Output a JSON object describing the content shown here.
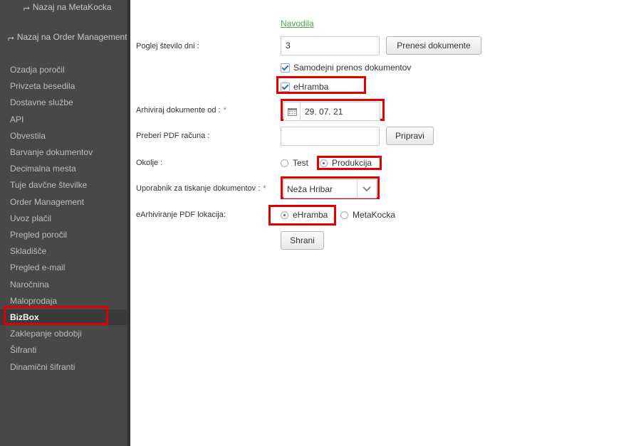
{
  "sidebar": {
    "back_metakocka": "Nazaj na MetaKocka",
    "back_order_management": "Nazaj na Order Management",
    "items": [
      {
        "label": "Ozadja poročil"
      },
      {
        "label": "Privzeta besedila"
      },
      {
        "label": "Dostavne službe"
      },
      {
        "label": "API"
      },
      {
        "label": "Obvestila"
      },
      {
        "label": "Barvanje dokumentov"
      },
      {
        "label": "Decimalna mesta"
      },
      {
        "label": "Tuje davčne številke"
      },
      {
        "label": "Order Management"
      },
      {
        "label": "Uvoz plačil"
      },
      {
        "label": "Pregled poročil"
      },
      {
        "label": "Skladišče"
      },
      {
        "label": "Pregled e-mail"
      },
      {
        "label": "Naročnina"
      },
      {
        "label": "Maloprodaja"
      },
      {
        "label": "BizBox"
      },
      {
        "label": "Zaklepanje obdobji"
      },
      {
        "label": "Šifranti"
      },
      {
        "label": "Dinamični šifranti"
      }
    ],
    "active": "BizBox"
  },
  "form": {
    "instructions_link": "Navodila",
    "days_label": "Poglej število dni :",
    "days_value": "3",
    "transfer_button": "Prenesi dokumente",
    "auto_transfer_label": "Samodejni prenos dokumentov",
    "ehramba_check_label": "eHramba",
    "archive_from_label": "Arhiviraj dokumente od :",
    "archive_from_value": "29. 07. 21",
    "review_pdf_label": "Preberi PDF računa :",
    "review_pdf_value": "",
    "prepare_button": "Pripravi",
    "environment_label": "Okolje :",
    "env_test": "Test",
    "env_production": "Produkcija",
    "print_user_label": "Uporabnik za tiskanje dokumentov :",
    "print_user_value": "Neža Hribar",
    "pdf_location_label": "eArhiviranje PDF lokacija:",
    "loc_ehramba": "eHramba",
    "loc_metakocka": "MetaKocka",
    "save_button": "Shrani",
    "required_mark": "*"
  },
  "colors": {
    "sidebar_bg": "#484848",
    "highlight": "#e00000",
    "link": "#4aa84a",
    "accent": "#2a6fc9"
  }
}
